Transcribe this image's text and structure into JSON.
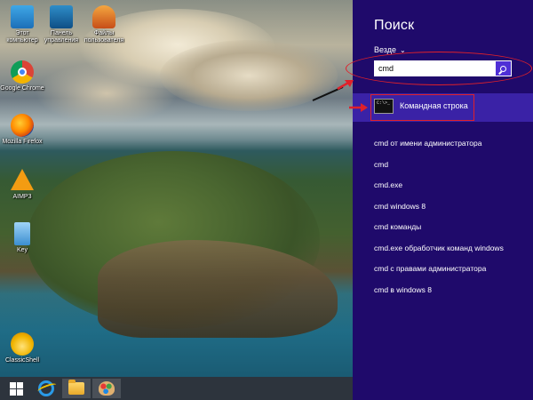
{
  "desktop": {
    "icons": [
      {
        "label": "Этот компьютер",
        "icon": "computer-icon"
      },
      {
        "label": "Панель управления",
        "icon": "control-panel-icon"
      },
      {
        "label": "Key",
        "icon": "key-icon"
      },
      {
        "label": "Google Chrome",
        "icon": "chrome-icon"
      },
      {
        "label": "Mozilla Firefox",
        "icon": "firefox-icon"
      },
      {
        "label": "AIMP3",
        "icon": "aimp-icon"
      },
      {
        "label": "ClassicShell",
        "icon": "classicshell-icon"
      }
    ],
    "user_folder_label": "Файлы пользователя"
  },
  "taskbar": {
    "items": [
      {
        "icon": "windows-start-icon"
      },
      {
        "icon": "internet-explorer-icon"
      },
      {
        "icon": "file-explorer-icon"
      },
      {
        "icon": "paint-icon"
      }
    ]
  },
  "search_charm": {
    "title": "Поиск",
    "scope": "Везде",
    "query": "cmd",
    "best_match": {
      "label": "Командная строка",
      "icon": "command-prompt-icon"
    },
    "suggestions": [
      "cmd от имени администратора",
      "cmd",
      "cmd.exe",
      "cmd windows 8",
      "cmd команды",
      "cmd.exe обработчик команд windows",
      "cmd с правами администратора",
      "cmd в windows 8"
    ]
  },
  "colors": {
    "charm_bg": "#1f0a6b",
    "best_match_bg": "#3a22a6",
    "search_button": "#4f2fd6",
    "annotation_red": "#e0202a"
  }
}
